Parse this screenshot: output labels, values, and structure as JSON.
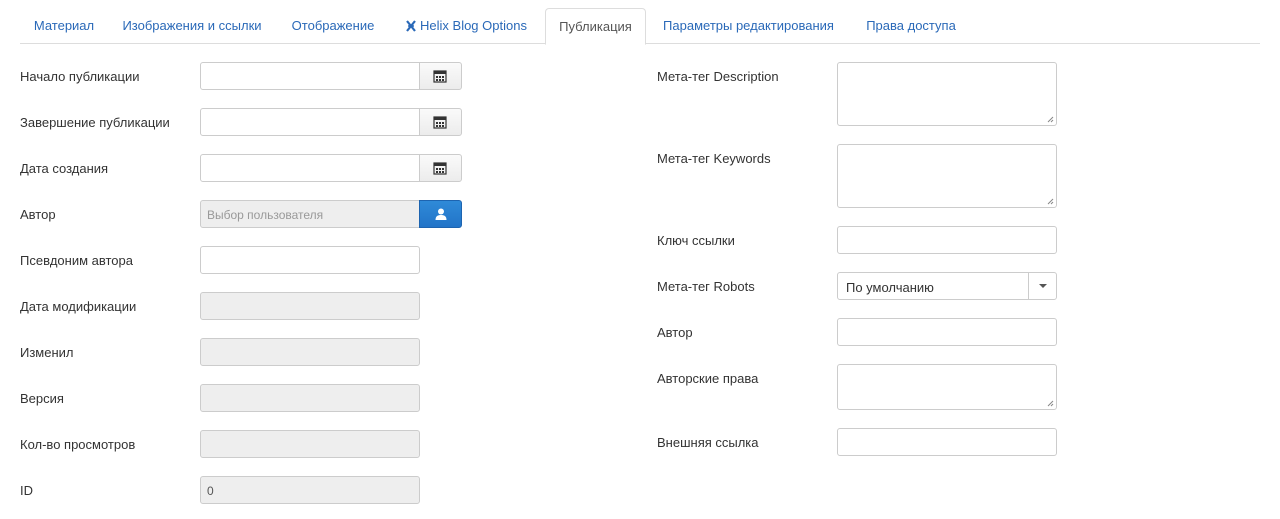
{
  "tabs": [
    {
      "label": "Материал"
    },
    {
      "label": "Изображения и ссылки"
    },
    {
      "label": "Отображение"
    },
    {
      "label": "Helix Blog Options"
    },
    {
      "label": "Публикация"
    },
    {
      "label": "Параметры редактирования"
    },
    {
      "label": "Права доступа"
    }
  ],
  "left": {
    "publish_up": {
      "label": "Начало публикации",
      "value": ""
    },
    "publish_down": {
      "label": "Завершение публикации",
      "value": ""
    },
    "created": {
      "label": "Дата создания",
      "value": ""
    },
    "author": {
      "label": "Автор",
      "placeholder": "Выбор пользователя"
    },
    "alias": {
      "label": "Псевдоним автора",
      "value": ""
    },
    "modified": {
      "label": "Дата модификации",
      "value": ""
    },
    "modified_by": {
      "label": "Изменил",
      "value": ""
    },
    "version": {
      "label": "Версия",
      "value": ""
    },
    "hits": {
      "label": "Кол-во просмотров",
      "value": ""
    },
    "id": {
      "label": "ID",
      "value": "0"
    }
  },
  "right": {
    "metadesc": {
      "label": "Мета-тег Description",
      "value": ""
    },
    "metakey": {
      "label": "Мета-тег Keywords",
      "value": ""
    },
    "xreference": {
      "label": "Ключ ссылки",
      "value": ""
    },
    "robots": {
      "label": "Мета-тег Robots",
      "selected": "По умолчанию"
    },
    "author": {
      "label": "Автор",
      "value": ""
    },
    "rights": {
      "label": "Авторские права",
      "value": ""
    },
    "external": {
      "label": "Внешняя ссылка",
      "value": ""
    }
  },
  "icons": {
    "calendar": "calendar-icon",
    "user": "user-icon",
    "helix": "helix-icon"
  },
  "colors": {
    "link": "#2a69b8",
    "primary_button": "#2274c8",
    "disabled_bg": "#eeeeee"
  }
}
